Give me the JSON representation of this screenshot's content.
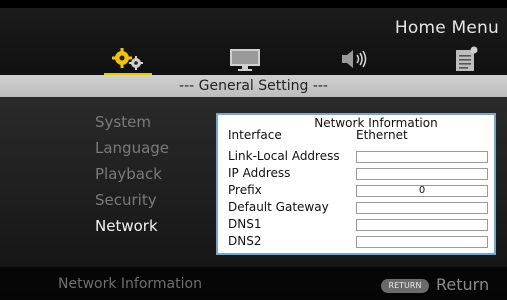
{
  "header": {
    "title": "Home Menu"
  },
  "icons": [
    "gear-icon",
    "monitor-icon",
    "speaker-icon",
    "document-icon"
  ],
  "colors": {
    "accent": "#f0c400",
    "panel_border": "#7aa6c6"
  },
  "section": {
    "title": "--- General Setting ---"
  },
  "menu": {
    "items": [
      {
        "label": "System"
      },
      {
        "label": "Language"
      },
      {
        "label": "Playback"
      },
      {
        "label": "Security"
      },
      {
        "label": "Network"
      }
    ],
    "selected": "Network"
  },
  "panel": {
    "title": "Network Information",
    "interface": {
      "label": "Interface",
      "value": "Ethernet"
    },
    "rows": [
      {
        "label": "Link-Local Address",
        "value": ""
      },
      {
        "label": "IP Address",
        "value": ""
      },
      {
        "label": "Prefix",
        "value": "0"
      },
      {
        "label": "Default Gateway",
        "value": ""
      },
      {
        "label": "DNS1",
        "value": ""
      },
      {
        "label": "DNS2",
        "value": ""
      }
    ]
  },
  "footer": {
    "left": "Network Information",
    "return_badge": "RETURN",
    "return_label": "Return"
  }
}
